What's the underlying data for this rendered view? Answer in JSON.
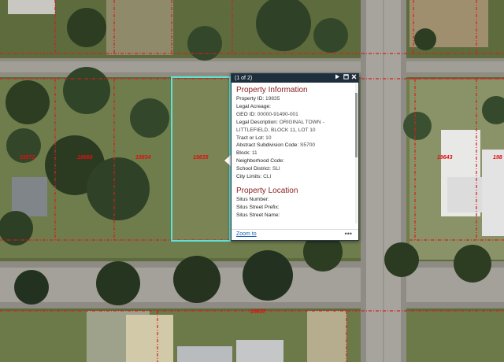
{
  "map": {
    "colors": {
      "parcel_line": "#d81e1e",
      "selected_outline": "#5fe0d8",
      "road": "#9c9a92",
      "grass": "#5d6b3d",
      "tree": "#2c3d22"
    },
    "parcel_labels": [
      "19672",
      "19666",
      "19834",
      "19835",
      "19643",
      "198",
      "19837"
    ]
  },
  "popup": {
    "counter": "(1 of 2)",
    "buttons": {
      "next_icon": "play-next-icon",
      "maximize_icon": "maximize-icon",
      "close_icon": "close-icon"
    },
    "sections": [
      {
        "title": "Property Information",
        "attributes": [
          {
            "key": "Property ID:",
            "value": "19835"
          },
          {
            "key": "Legal Acreage:",
            "value": ""
          },
          {
            "key": "GEO ID:",
            "value": "00000-91490-001"
          },
          {
            "key": "Legal Description:",
            "value": "ORIGINAL TOWN - LITTLEFIELD, BLOCK 11, LOT 10"
          },
          {
            "key": "Tract or Lot:",
            "value": "10"
          },
          {
            "key": "Abstract Subdivision Code:",
            "value": "S5700"
          },
          {
            "key": "Block:",
            "value": "11"
          },
          {
            "key": "Neighborhood Code:",
            "value": ""
          },
          {
            "key": "School District:",
            "value": "SLI"
          },
          {
            "key": "City Limits:",
            "value": "CLI"
          }
        ]
      },
      {
        "title": "Property Location",
        "attributes": [
          {
            "key": "Situs Number:",
            "value": ""
          },
          {
            "key": "Situs Street Prefix:",
            "value": ""
          },
          {
            "key": "Situs Street Name:",
            "value": ""
          }
        ]
      }
    ],
    "footer": {
      "zoom_label": "Zoom to",
      "more_label": "•••"
    }
  }
}
